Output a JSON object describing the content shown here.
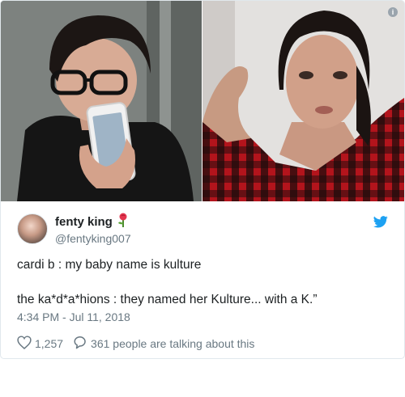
{
  "tweet": {
    "display_name": "fenty king",
    "handle": "@fentyking007",
    "text_line1": "cardi b : my baby name is kulture",
    "text_line2": "the ka*d*a*hions : they named her Kulture... with a K.”",
    "timestamp": "4:34 PM - Jul 11, 2018",
    "like_count": "1,257",
    "talking_text": "361 people are talking about this"
  },
  "icons": {
    "info": "info-icon",
    "brand": "twitter-bird-icon",
    "emoji": "rose-icon",
    "like": "heart-icon",
    "reply": "speech-bubble-icon"
  },
  "colors": {
    "brand_blue": "#1da1f2",
    "muted_text": "#697882",
    "border": "#e1e8ed"
  }
}
